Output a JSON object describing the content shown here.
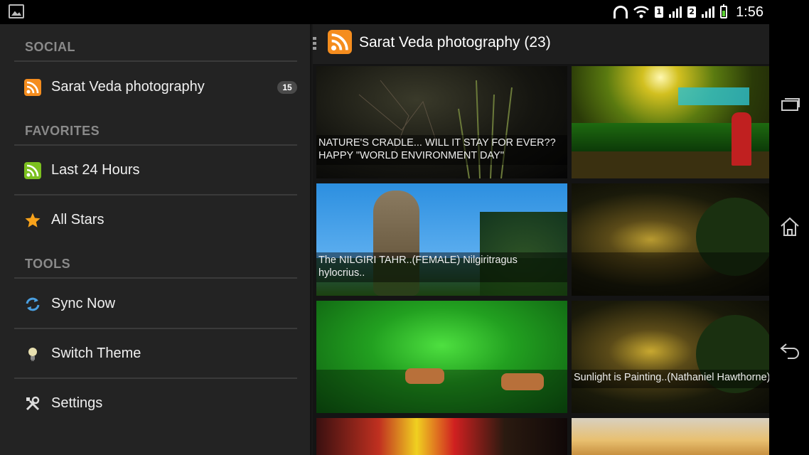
{
  "status": {
    "clock": "1:56",
    "sim1": "1",
    "sim2": "2"
  },
  "drawer": {
    "sections": [
      {
        "title": "SOCIAL",
        "items": [
          {
            "label": "Sarat Veda photography",
            "icon": "rss-icon",
            "badge": "15"
          }
        ]
      },
      {
        "title": "FAVORITES",
        "items": [
          {
            "label": "Last 24 Hours",
            "icon": "rss-green-icon"
          },
          {
            "label": "All Stars",
            "icon": "star-icon"
          }
        ]
      },
      {
        "title": "TOOLS",
        "items": [
          {
            "label": "Sync Now",
            "icon": "sync-icon"
          },
          {
            "label": "Switch Theme",
            "icon": "lightbulb-icon"
          },
          {
            "label": "Settings",
            "icon": "wrench-icon"
          }
        ]
      }
    ]
  },
  "toolbar": {
    "title": "Sarat Veda photography (23)"
  },
  "tiles": [
    {
      "caption": "NATURE'S CRADLE... WILL IT STAY FOR EVER?? HAPPY \"WORLD ENVIRONMENT DAY\""
    },
    {
      "caption": ""
    },
    {
      "caption": "The NILGIRI TAHR..(FEMALE) Nilgiritragus hylocrius.."
    },
    {
      "caption": ""
    },
    {
      "caption": ""
    },
    {
      "caption": "Sunlight is Painting..(Nathaniel Hawthorne)"
    }
  ],
  "colors": {
    "drawer_bg": "#232323",
    "accent_rss": "#f58d1e",
    "accent_green": "#7cc01f"
  }
}
